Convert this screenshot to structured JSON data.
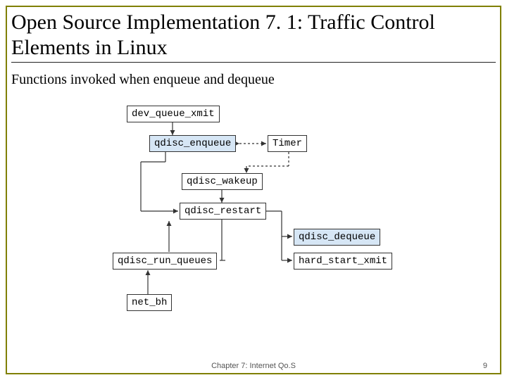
{
  "title": "Open Source Implementation 7. 1: Traffic Control Elements in Linux",
  "subtitle": "Functions invoked when enqueue and dequeue",
  "boxes": {
    "dev_queue_xmit": "dev_queue_xmit",
    "qdisc_enqueue": "qdisc_enqueue",
    "timer": "Timer",
    "qdisc_wakeup": "qdisc_wakeup",
    "qdisc_restart": "qdisc_restart",
    "qdisc_dequeue": "qdisc_dequeue",
    "hard_start_xmit": "hard_start_xmit",
    "qdisc_run_queues": "qdisc_run_queues",
    "net_bh": "net_bh"
  },
  "footer": {
    "chapter": "Chapter 7: Internet Qo.S",
    "page": "9"
  },
  "colors": {
    "border": "#808000",
    "box_blue": "#d6e6f5"
  }
}
